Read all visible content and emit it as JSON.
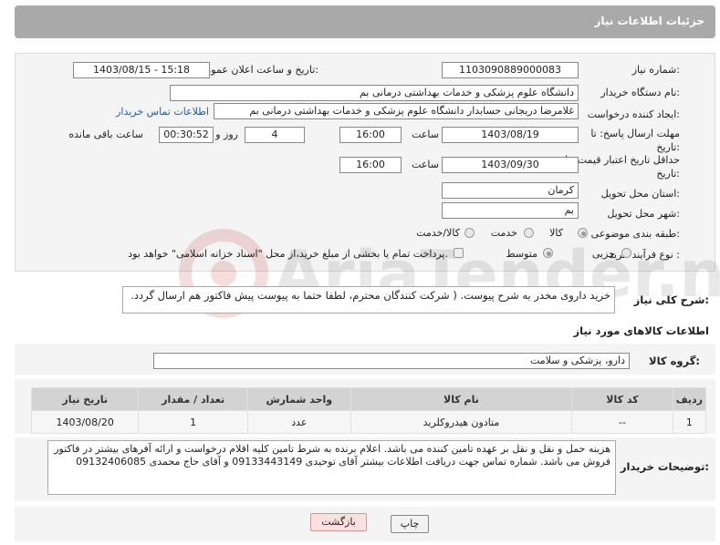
{
  "header": {
    "title": "جزئیات اطلاعات نیاز"
  },
  "fields": {
    "need_number_label": "شماره نیاز:",
    "need_number": "1103090889000083",
    "announce_label": "تاریخ و ساعت اعلان عمومی:",
    "announce_value": "1403/08/15 - 15:18",
    "buyer_org_label": "نام دستگاه خریدار:",
    "buyer_org": "دانشگاه علوم پزشکی و خدمات بهداشتی  درمانی بم",
    "requester_label": "ایجاد کننده درخواست:",
    "requester": "غلامرضا دریجانی حسابدار دانشگاه علوم پزشکی و خدمات بهداشتی  درمانی بم",
    "contact_link": "اطلاعات تماس خریدار",
    "reply_deadline_label": "مهلت ارسال پاسخ: تا تاریخ:",
    "reply_date": "1403/08/19",
    "time_label": "ساعت",
    "reply_time": "16:00",
    "days_value": "4",
    "days_label": "روز و",
    "remaining_value": "00:30:52",
    "remaining_label": "ساعت باقی مانده",
    "price_validity_label": "حداقل تاریخ اعتبار قیمت: تا تاریخ:",
    "price_date": "1403/09/30",
    "price_time": "16:00",
    "province_label": "استان محل تحویل:",
    "province": "کرمان",
    "city_label": "شهر محل تحویل:",
    "city": "بم",
    "category_label": "طبقه بندی موضوعی:",
    "category_options": [
      "کالا",
      "خدمت",
      "کالا/خدمت"
    ],
    "category_selected": "کالا",
    "purchase_type_label": "نوع فرآیند خرید :",
    "purchase_options": [
      "جزیی",
      "متوسط"
    ],
    "purchase_selected": "متوسط",
    "payment_note": "پرداخت تمام یا بخشی از مبلغ خرید،از محل \"اسناد خزانه اسلامی\" خواهد بود."
  },
  "description": {
    "label": "شرح کلی نیاز:",
    "text": "خرید داروی مخدر به شرح پیوست. ( شرکت کنندگان محترم، لطفا حتما به پیوست پیش فاکتور هم ارسال گردد."
  },
  "goods_section": {
    "title": "اطلاعات کالاهای مورد نیاز",
    "group_label": "گروه کالا:",
    "group_value": "دارو، پزشکی و سلامت"
  },
  "table": {
    "headers": [
      "ردیف",
      "کد کالا",
      "نام کالا",
      "واحد شمارش",
      "تعداد / مقدار",
      "تاریخ نیاز"
    ],
    "rows": [
      [
        "1",
        "--",
        "متادون هیدروکلرید",
        "عدد",
        "1",
        "1403/08/20"
      ]
    ]
  },
  "buyer_notes": {
    "label": "توضیحات خریدار:",
    "text": "هزینه حمل و نقل و نقل بر عهده تامین کننده می باشد. اعلام برنده به شرط تامین کلیه اقلام درخواست و ارائه آفرهای بیشتر در فاکتور فروش می باشد. شماره تماس جهت دریافت اطلاعات بیشتر آقای توحیدی 09133443149 و آقای حاج محمدی 09132406085"
  },
  "buttons": {
    "print": "چاپ",
    "back": "بازگشت"
  },
  "watermark": {
    "text": "AriaTender.neT"
  },
  "colors": {
    "header_bg": "#a9a9a9",
    "link": "#1f5cb5",
    "back_button_bg": "#ffe0e0"
  }
}
